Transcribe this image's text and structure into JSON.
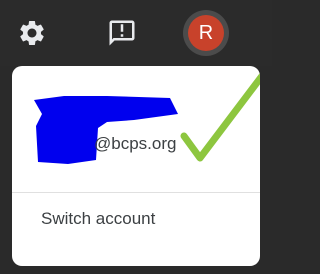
{
  "topbar": {
    "settings_icon": "gear-icon",
    "feedback_icon": "feedback-icon",
    "avatar_initial": "R",
    "avatar_color": "#c8422b"
  },
  "account_menu": {
    "email_suffix": "@bcps.org",
    "redaction_color": "#0000ee",
    "checkmark_color": "#8dc63f",
    "switch_account_label": "Switch account"
  }
}
